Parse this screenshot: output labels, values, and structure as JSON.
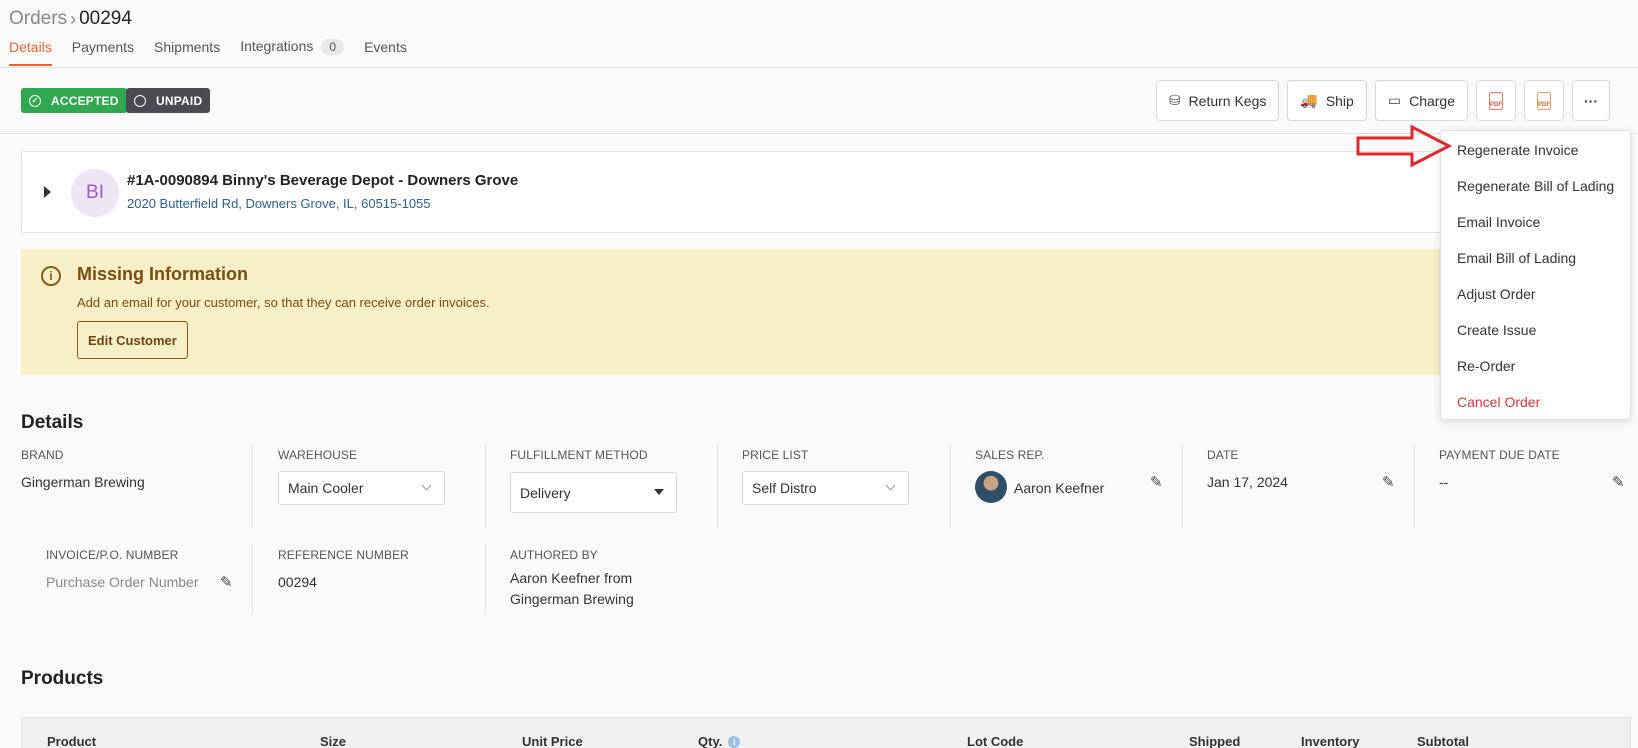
{
  "breadcrumb": {
    "root": "Orders",
    "current": "00294"
  },
  "tabs": [
    {
      "label": "Details",
      "active": true
    },
    {
      "label": "Payments"
    },
    {
      "label": "Shipments"
    },
    {
      "label": "Integrations",
      "count": "0"
    },
    {
      "label": "Events"
    }
  ],
  "status": {
    "accepted": "ACCEPTED",
    "unpaid": "UNPAID"
  },
  "actions": {
    "return_kegs": "Return Kegs",
    "ship": "Ship",
    "charge": "Charge",
    "pdf": "PDF",
    "more": "···"
  },
  "customer": {
    "initials": "BI",
    "name": "#1A-0090894 Binny's Beverage Depot - Downers Grove",
    "address": "2020 Butterfield Rd, Downers Grove, IL, 60515-1055"
  },
  "alert": {
    "title": "Missing Information",
    "text": "Add an email for your customer, so that they can receive order invoices.",
    "button": "Edit Customer"
  },
  "details": {
    "title": "Details",
    "brand": {
      "label": "Brand",
      "value": "Gingerman Brewing"
    },
    "warehouse": {
      "label": "Warehouse",
      "value": "Main Cooler"
    },
    "fulfillment": {
      "label": "Fulfillment Method",
      "value": "Delivery"
    },
    "price_list": {
      "label": "Price List",
      "value": "Self Distro"
    },
    "sales_rep": {
      "label": "Sales Rep.",
      "value": "Aaron Keefner"
    },
    "date": {
      "label": "Date",
      "value": "Jan 17, 2024"
    },
    "payment_due": {
      "label": "Payment Due Date",
      "value": "--"
    },
    "invoice": {
      "label": "Invoice/P.O. Number",
      "placeholder": "Purchase Order Number"
    },
    "reference": {
      "label": "Reference Number",
      "value": "00294"
    },
    "authored": {
      "label": "Authored By",
      "line1": "Aaron Keefner from",
      "line2": "Gingerman Brewing"
    }
  },
  "products": {
    "title": "Products",
    "columns": [
      "Product",
      "Size",
      "Unit Price",
      "Qty.",
      "Lot Code",
      "Shipped",
      "Inventory",
      "Subtotal"
    ]
  },
  "menu": {
    "items": [
      "Regenerate Invoice",
      "Regenerate Bill of Lading",
      "Email Invoice",
      "Email Bill of Lading",
      "Adjust Order",
      "Create Issue",
      "Re-Order",
      "Cancel Order"
    ]
  },
  "colors": {
    "accent": "#e2682f",
    "accepted": "#2fa84f",
    "unpaid": "#4a4a52",
    "danger": "#d9363e",
    "annotation": "#e0282e"
  }
}
